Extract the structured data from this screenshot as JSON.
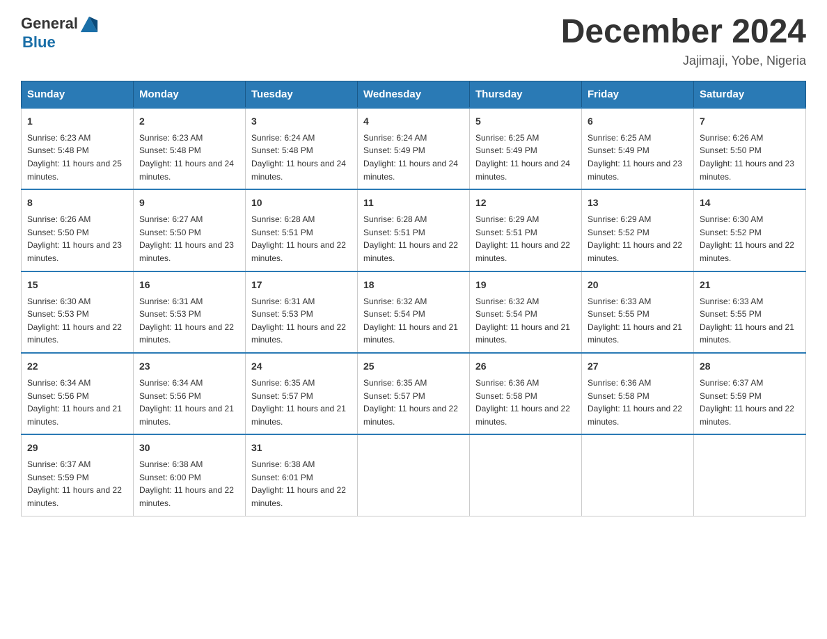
{
  "header": {
    "logo_general": "General",
    "logo_blue": "Blue",
    "month_title": "December 2024",
    "location": "Jajimaji, Yobe, Nigeria"
  },
  "days_of_week": [
    "Sunday",
    "Monday",
    "Tuesday",
    "Wednesday",
    "Thursday",
    "Friday",
    "Saturday"
  ],
  "weeks": [
    [
      {
        "day": "1",
        "sunrise": "6:23 AM",
        "sunset": "5:48 PM",
        "daylight": "11 hours and 25 minutes."
      },
      {
        "day": "2",
        "sunrise": "6:23 AM",
        "sunset": "5:48 PM",
        "daylight": "11 hours and 24 minutes."
      },
      {
        "day": "3",
        "sunrise": "6:24 AM",
        "sunset": "5:48 PM",
        "daylight": "11 hours and 24 minutes."
      },
      {
        "day": "4",
        "sunrise": "6:24 AM",
        "sunset": "5:49 PM",
        "daylight": "11 hours and 24 minutes."
      },
      {
        "day": "5",
        "sunrise": "6:25 AM",
        "sunset": "5:49 PM",
        "daylight": "11 hours and 24 minutes."
      },
      {
        "day": "6",
        "sunrise": "6:25 AM",
        "sunset": "5:49 PM",
        "daylight": "11 hours and 23 minutes."
      },
      {
        "day": "7",
        "sunrise": "6:26 AM",
        "sunset": "5:50 PM",
        "daylight": "11 hours and 23 minutes."
      }
    ],
    [
      {
        "day": "8",
        "sunrise": "6:26 AM",
        "sunset": "5:50 PM",
        "daylight": "11 hours and 23 minutes."
      },
      {
        "day": "9",
        "sunrise": "6:27 AM",
        "sunset": "5:50 PM",
        "daylight": "11 hours and 23 minutes."
      },
      {
        "day": "10",
        "sunrise": "6:28 AM",
        "sunset": "5:51 PM",
        "daylight": "11 hours and 22 minutes."
      },
      {
        "day": "11",
        "sunrise": "6:28 AM",
        "sunset": "5:51 PM",
        "daylight": "11 hours and 22 minutes."
      },
      {
        "day": "12",
        "sunrise": "6:29 AM",
        "sunset": "5:51 PM",
        "daylight": "11 hours and 22 minutes."
      },
      {
        "day": "13",
        "sunrise": "6:29 AM",
        "sunset": "5:52 PM",
        "daylight": "11 hours and 22 minutes."
      },
      {
        "day": "14",
        "sunrise": "6:30 AM",
        "sunset": "5:52 PM",
        "daylight": "11 hours and 22 minutes."
      }
    ],
    [
      {
        "day": "15",
        "sunrise": "6:30 AM",
        "sunset": "5:53 PM",
        "daylight": "11 hours and 22 minutes."
      },
      {
        "day": "16",
        "sunrise": "6:31 AM",
        "sunset": "5:53 PM",
        "daylight": "11 hours and 22 minutes."
      },
      {
        "day": "17",
        "sunrise": "6:31 AM",
        "sunset": "5:53 PM",
        "daylight": "11 hours and 22 minutes."
      },
      {
        "day": "18",
        "sunrise": "6:32 AM",
        "sunset": "5:54 PM",
        "daylight": "11 hours and 21 minutes."
      },
      {
        "day": "19",
        "sunrise": "6:32 AM",
        "sunset": "5:54 PM",
        "daylight": "11 hours and 21 minutes."
      },
      {
        "day": "20",
        "sunrise": "6:33 AM",
        "sunset": "5:55 PM",
        "daylight": "11 hours and 21 minutes."
      },
      {
        "day": "21",
        "sunrise": "6:33 AM",
        "sunset": "5:55 PM",
        "daylight": "11 hours and 21 minutes."
      }
    ],
    [
      {
        "day": "22",
        "sunrise": "6:34 AM",
        "sunset": "5:56 PM",
        "daylight": "11 hours and 21 minutes."
      },
      {
        "day": "23",
        "sunrise": "6:34 AM",
        "sunset": "5:56 PM",
        "daylight": "11 hours and 21 minutes."
      },
      {
        "day": "24",
        "sunrise": "6:35 AM",
        "sunset": "5:57 PM",
        "daylight": "11 hours and 21 minutes."
      },
      {
        "day": "25",
        "sunrise": "6:35 AM",
        "sunset": "5:57 PM",
        "daylight": "11 hours and 22 minutes."
      },
      {
        "day": "26",
        "sunrise": "6:36 AM",
        "sunset": "5:58 PM",
        "daylight": "11 hours and 22 minutes."
      },
      {
        "day": "27",
        "sunrise": "6:36 AM",
        "sunset": "5:58 PM",
        "daylight": "11 hours and 22 minutes."
      },
      {
        "day": "28",
        "sunrise": "6:37 AM",
        "sunset": "5:59 PM",
        "daylight": "11 hours and 22 minutes."
      }
    ],
    [
      {
        "day": "29",
        "sunrise": "6:37 AM",
        "sunset": "5:59 PM",
        "daylight": "11 hours and 22 minutes."
      },
      {
        "day": "30",
        "sunrise": "6:38 AM",
        "sunset": "6:00 PM",
        "daylight": "11 hours and 22 minutes."
      },
      {
        "day": "31",
        "sunrise": "6:38 AM",
        "sunset": "6:01 PM",
        "daylight": "11 hours and 22 minutes."
      },
      null,
      null,
      null,
      null
    ]
  ]
}
